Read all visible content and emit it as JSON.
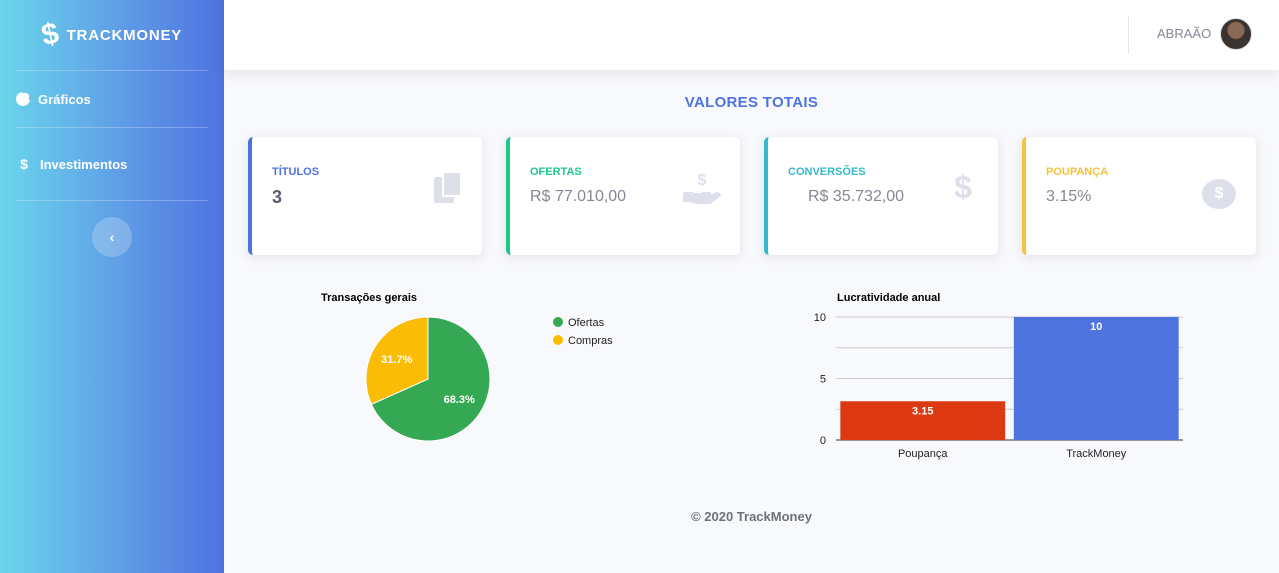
{
  "sidebar": {
    "brand": "TRACKMONEY",
    "items": [
      {
        "label": "Gráficos",
        "icon": "pie-chart-icon"
      },
      {
        "label": "Investimentos",
        "icon": "dollar-icon"
      }
    ],
    "toggle_icon": "chevron-left-icon"
  },
  "topbar": {
    "user_name": "ABRAÃO"
  },
  "main": {
    "title": "VALORES TOTAIS",
    "cards": [
      {
        "label": "TÍTULOS",
        "value": "3",
        "icon": "documents-icon",
        "color": "#4e73df"
      },
      {
        "label": "OFERTAS",
        "value": "R$ 77.010,00",
        "icon": "hand-holding-usd-icon",
        "color": "#1cc88a"
      },
      {
        "label": "CONVERSÕES",
        "value": "R$ 35.732,00",
        "icon": "dollar-icon",
        "color": "#36b9cc"
      },
      {
        "label": "POUPANÇA",
        "value": "3.15%",
        "icon": "comment-dollar-icon",
        "color": "#f6c23e"
      }
    ]
  },
  "chart_data": [
    {
      "type": "pie",
      "title": "Transações gerais",
      "labels": [
        "Ofertas",
        "Compras"
      ],
      "values": [
        68.3,
        31.7
      ],
      "colors": [
        "#34a853",
        "#fbbc05"
      ],
      "slice_labels": [
        "68.3%",
        "31.7%"
      ],
      "legend": "right"
    },
    {
      "type": "bar",
      "title": "Lucratividade anual",
      "categories": [
        "Poupança",
        "TrackMoney"
      ],
      "values": [
        3.15,
        10
      ],
      "data_labels": [
        "3.15",
        "10"
      ],
      "colors": [
        "#dc3912",
        "#4e73df"
      ],
      "ylim": [
        0,
        10
      ],
      "yticks": [
        "0",
        "5",
        "10"
      ],
      "grid": true
    }
  ],
  "footer": "© 2020 TrackMoney"
}
